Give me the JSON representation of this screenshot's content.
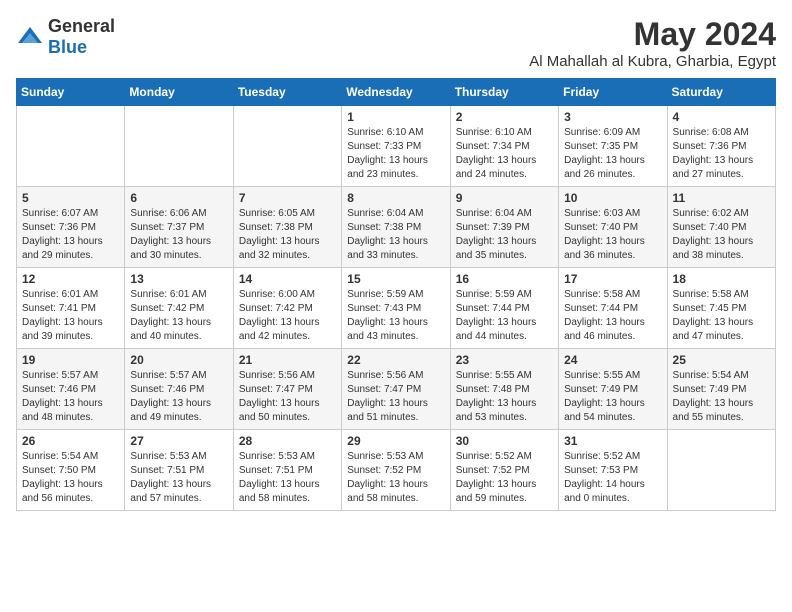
{
  "header": {
    "logo_general": "General",
    "logo_blue": "Blue",
    "title": "May 2024",
    "subtitle": "Al Mahallah al Kubra, Gharbia, Egypt"
  },
  "days_of_week": [
    "Sunday",
    "Monday",
    "Tuesday",
    "Wednesday",
    "Thursday",
    "Friday",
    "Saturday"
  ],
  "weeks": [
    [
      {
        "day": "",
        "content": ""
      },
      {
        "day": "",
        "content": ""
      },
      {
        "day": "",
        "content": ""
      },
      {
        "day": "1",
        "content": "Sunrise: 6:10 AM\nSunset: 7:33 PM\nDaylight: 13 hours\nand 23 minutes."
      },
      {
        "day": "2",
        "content": "Sunrise: 6:10 AM\nSunset: 7:34 PM\nDaylight: 13 hours\nand 24 minutes."
      },
      {
        "day": "3",
        "content": "Sunrise: 6:09 AM\nSunset: 7:35 PM\nDaylight: 13 hours\nand 26 minutes."
      },
      {
        "day": "4",
        "content": "Sunrise: 6:08 AM\nSunset: 7:36 PM\nDaylight: 13 hours\nand 27 minutes."
      }
    ],
    [
      {
        "day": "5",
        "content": "Sunrise: 6:07 AM\nSunset: 7:36 PM\nDaylight: 13 hours\nand 29 minutes."
      },
      {
        "day": "6",
        "content": "Sunrise: 6:06 AM\nSunset: 7:37 PM\nDaylight: 13 hours\nand 30 minutes."
      },
      {
        "day": "7",
        "content": "Sunrise: 6:05 AM\nSunset: 7:38 PM\nDaylight: 13 hours\nand 32 minutes."
      },
      {
        "day": "8",
        "content": "Sunrise: 6:04 AM\nSunset: 7:38 PM\nDaylight: 13 hours\nand 33 minutes."
      },
      {
        "day": "9",
        "content": "Sunrise: 6:04 AM\nSunset: 7:39 PM\nDaylight: 13 hours\nand 35 minutes."
      },
      {
        "day": "10",
        "content": "Sunrise: 6:03 AM\nSunset: 7:40 PM\nDaylight: 13 hours\nand 36 minutes."
      },
      {
        "day": "11",
        "content": "Sunrise: 6:02 AM\nSunset: 7:40 PM\nDaylight: 13 hours\nand 38 minutes."
      }
    ],
    [
      {
        "day": "12",
        "content": "Sunrise: 6:01 AM\nSunset: 7:41 PM\nDaylight: 13 hours\nand 39 minutes."
      },
      {
        "day": "13",
        "content": "Sunrise: 6:01 AM\nSunset: 7:42 PM\nDaylight: 13 hours\nand 40 minutes."
      },
      {
        "day": "14",
        "content": "Sunrise: 6:00 AM\nSunset: 7:42 PM\nDaylight: 13 hours\nand 42 minutes."
      },
      {
        "day": "15",
        "content": "Sunrise: 5:59 AM\nSunset: 7:43 PM\nDaylight: 13 hours\nand 43 minutes."
      },
      {
        "day": "16",
        "content": "Sunrise: 5:59 AM\nSunset: 7:44 PM\nDaylight: 13 hours\nand 44 minutes."
      },
      {
        "day": "17",
        "content": "Sunrise: 5:58 AM\nSunset: 7:44 PM\nDaylight: 13 hours\nand 46 minutes."
      },
      {
        "day": "18",
        "content": "Sunrise: 5:58 AM\nSunset: 7:45 PM\nDaylight: 13 hours\nand 47 minutes."
      }
    ],
    [
      {
        "day": "19",
        "content": "Sunrise: 5:57 AM\nSunset: 7:46 PM\nDaylight: 13 hours\nand 48 minutes."
      },
      {
        "day": "20",
        "content": "Sunrise: 5:57 AM\nSunset: 7:46 PM\nDaylight: 13 hours\nand 49 minutes."
      },
      {
        "day": "21",
        "content": "Sunrise: 5:56 AM\nSunset: 7:47 PM\nDaylight: 13 hours\nand 50 minutes."
      },
      {
        "day": "22",
        "content": "Sunrise: 5:56 AM\nSunset: 7:47 PM\nDaylight: 13 hours\nand 51 minutes."
      },
      {
        "day": "23",
        "content": "Sunrise: 5:55 AM\nSunset: 7:48 PM\nDaylight: 13 hours\nand 53 minutes."
      },
      {
        "day": "24",
        "content": "Sunrise: 5:55 AM\nSunset: 7:49 PM\nDaylight: 13 hours\nand 54 minutes."
      },
      {
        "day": "25",
        "content": "Sunrise: 5:54 AM\nSunset: 7:49 PM\nDaylight: 13 hours\nand 55 minutes."
      }
    ],
    [
      {
        "day": "26",
        "content": "Sunrise: 5:54 AM\nSunset: 7:50 PM\nDaylight: 13 hours\nand 56 minutes."
      },
      {
        "day": "27",
        "content": "Sunrise: 5:53 AM\nSunset: 7:51 PM\nDaylight: 13 hours\nand 57 minutes."
      },
      {
        "day": "28",
        "content": "Sunrise: 5:53 AM\nSunset: 7:51 PM\nDaylight: 13 hours\nand 58 minutes."
      },
      {
        "day": "29",
        "content": "Sunrise: 5:53 AM\nSunset: 7:52 PM\nDaylight: 13 hours\nand 58 minutes."
      },
      {
        "day": "30",
        "content": "Sunrise: 5:52 AM\nSunset: 7:52 PM\nDaylight: 13 hours\nand 59 minutes."
      },
      {
        "day": "31",
        "content": "Sunrise: 5:52 AM\nSunset: 7:53 PM\nDaylight: 14 hours\nand 0 minutes."
      },
      {
        "day": "",
        "content": ""
      }
    ]
  ]
}
